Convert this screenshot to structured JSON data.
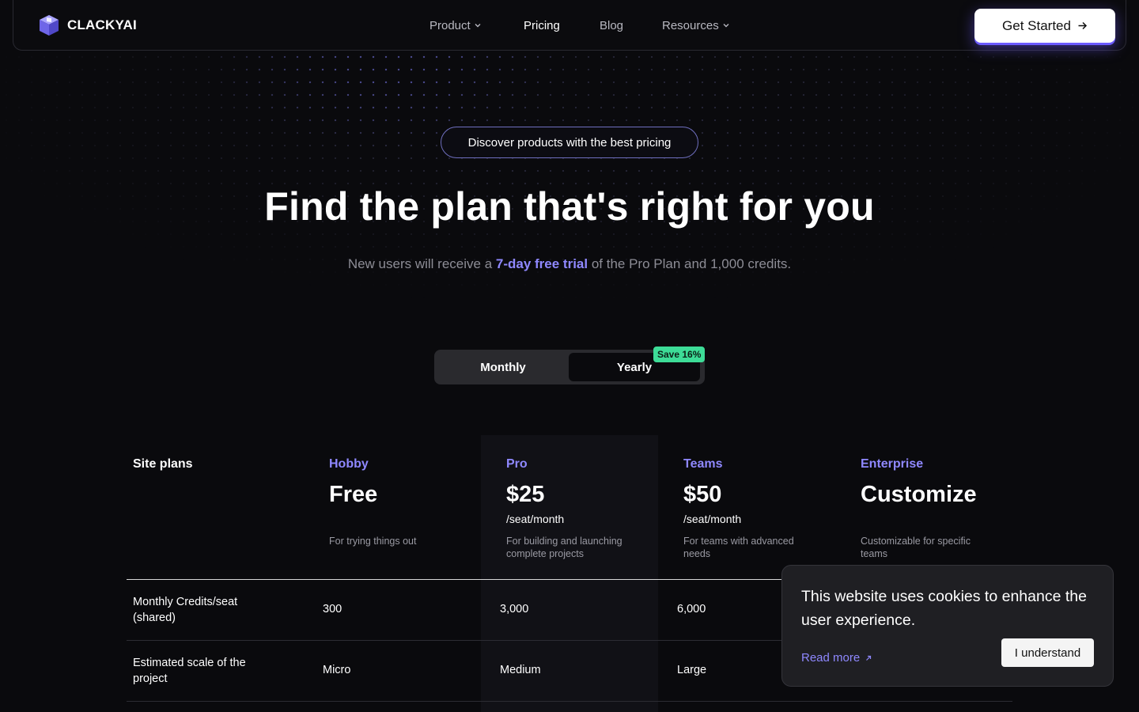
{
  "brand": {
    "name": "CLACKYAI",
    "accent": "#8f88ff"
  },
  "nav": {
    "items": [
      {
        "label": "Product",
        "has_dropdown": true
      },
      {
        "label": "Pricing",
        "has_dropdown": false,
        "active": true
      },
      {
        "label": "Blog",
        "has_dropdown": false
      },
      {
        "label": "Resources",
        "has_dropdown": true
      }
    ],
    "cta_label": "Get Started"
  },
  "hero": {
    "badge": "Discover products with the best pricing",
    "title": "Find the plan that's right for you",
    "subtitle_pre": "New users will receive a ",
    "subtitle_highlight": "7-day free trial",
    "subtitle_post": " of the Pro Plan and 1,000 credits."
  },
  "billing_toggle": {
    "options": [
      "Monthly",
      "Yearly"
    ],
    "selected": "Yearly",
    "save_badge": "Save 16%"
  },
  "plans": {
    "section_label": "Site plans",
    "items": [
      {
        "name": "Hobby",
        "price": "Free",
        "per": "",
        "desc": "For trying things out"
      },
      {
        "name": "Pro",
        "price": "$25",
        "per": "/seat/month",
        "desc": "For building and launching complete projects"
      },
      {
        "name": "Teams",
        "price": "$50",
        "per": "/seat/month",
        "desc": "For teams with advanced needs"
      },
      {
        "name": "Enterprise",
        "price": "Customize",
        "per": "",
        "desc": "Customizable for specific teams"
      }
    ],
    "rows": [
      {
        "label": "Monthly Credits/seat (shared)",
        "values": [
          "300",
          "3,000",
          "6,000"
        ]
      },
      {
        "label": "Estimated scale of the project",
        "values": [
          "Micro",
          "Medium",
          "Large"
        ]
      }
    ]
  },
  "cookie": {
    "message": "This website uses cookies to enhance the user experience.",
    "read_more": "Read more",
    "accept_label": "I understand"
  }
}
